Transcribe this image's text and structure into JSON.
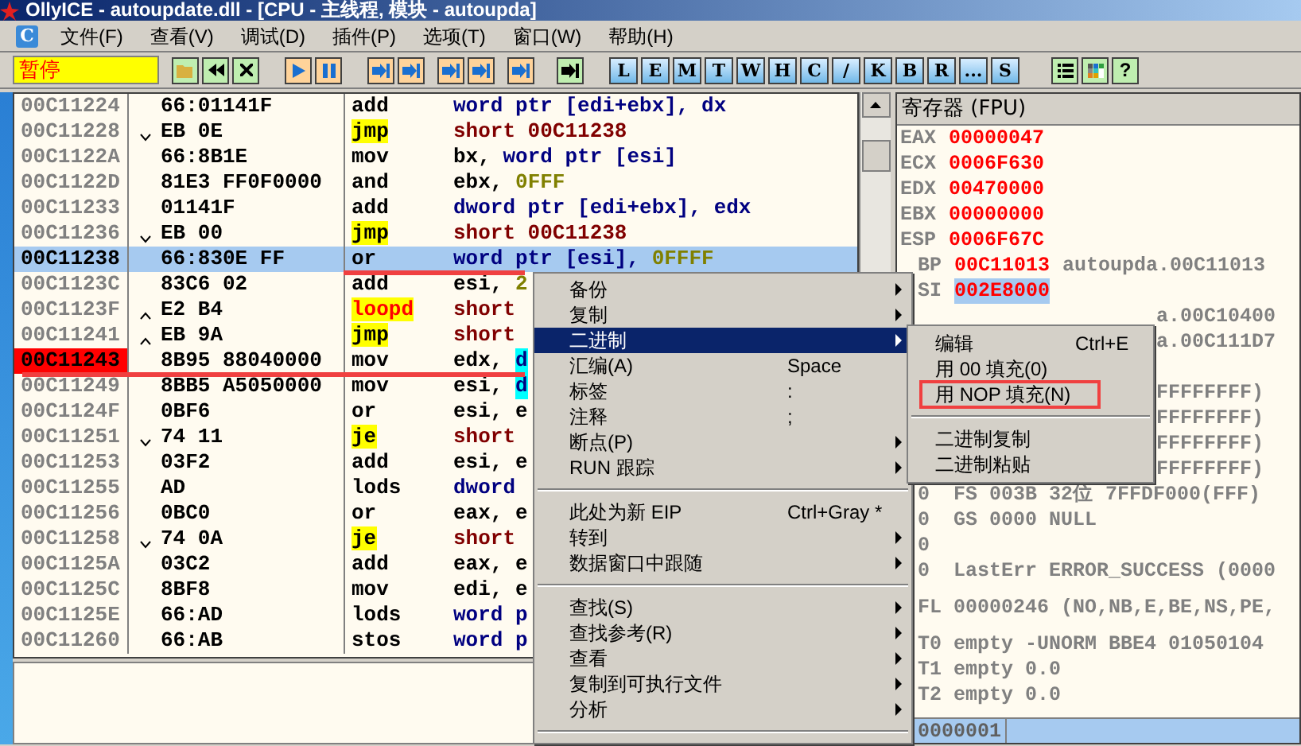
{
  "window": {
    "title": "OllyICE - autoupdate.dll - [CPU - 主线程, 模块 - autoupda]"
  },
  "menu_icon": "C",
  "menu": [
    "文件(F)",
    "查看(V)",
    "调试(D)",
    "插件(P)",
    "选项(T)",
    "窗口(W)",
    "帮助(H)"
  ],
  "toolbar": {
    "status": "暂停",
    "panel_buttons": [
      "L",
      "E",
      "M",
      "T",
      "W",
      "H",
      "C",
      "/",
      "K",
      "B",
      "R",
      "...",
      "S"
    ],
    "help_button": "?"
  },
  "disassembly": {
    "rows": [
      {
        "address": "00C11224",
        "hex": "66:01141F",
        "kind": "plain",
        "mnemonic": "add",
        "operand": [
          {
            "text": "word ptr [edi+ebx], dx",
            "kind": "mem"
          }
        ],
        "selected": false,
        "breakpoint": false,
        "underlined": false
      },
      {
        "address": "00C11228",
        "hex": "EB 0E",
        "kind": "jump_down",
        "mnemonic": "jmp",
        "operand": [
          {
            "text": "short 00C11238",
            "kind": "jump"
          }
        ],
        "selected": false,
        "breakpoint": false,
        "underlined": false
      },
      {
        "address": "00C1122A",
        "hex": "66:8B1E",
        "kind": "plain",
        "mnemonic": "mov",
        "operand": [
          {
            "text": "bx, ",
            "kind": "reg"
          },
          {
            "text": "word ptr [esi]",
            "kind": "mem"
          }
        ],
        "selected": false,
        "breakpoint": false,
        "underlined": false
      },
      {
        "address": "00C1122D",
        "hex": "81E3 FF0F0000",
        "kind": "plain",
        "mnemonic": "and",
        "operand": [
          {
            "text": "ebx, ",
            "kind": "reg"
          },
          {
            "text": "0FFF",
            "kind": "const"
          }
        ],
        "selected": false,
        "breakpoint": false,
        "underlined": false
      },
      {
        "address": "00C11233",
        "hex": "01141F",
        "kind": "plain",
        "mnemonic": "add",
        "operand": [
          {
            "text": "dword ptr [edi+ebx], edx",
            "kind": "mem"
          }
        ],
        "selected": false,
        "breakpoint": false,
        "underlined": false
      },
      {
        "address": "00C11236",
        "hex": "EB 00",
        "kind": "jump_down",
        "mnemonic": "jmp",
        "operand": [
          {
            "text": "short 00C11238",
            "kind": "jump"
          }
        ],
        "selected": false,
        "breakpoint": false,
        "underlined": false
      },
      {
        "address": "00C11238",
        "hex": "66:830E FF",
        "kind": "plain",
        "mnemonic": "or",
        "operand": [
          {
            "text": "word ptr [esi], ",
            "kind": "mem"
          },
          {
            "text": "0FFFF",
            "kind": "const"
          }
        ],
        "selected": true,
        "breakpoint": false,
        "underlined": true
      },
      {
        "address": "00C1123C",
        "hex": "83C6 02",
        "kind": "plain",
        "mnemonic": "add",
        "operand": [
          {
            "text": "esi, ",
            "kind": "reg"
          },
          {
            "text": "2",
            "kind": "const"
          }
        ],
        "selected": false,
        "breakpoint": false,
        "underlined": false
      },
      {
        "address": "00C1123F",
        "hex": "E2 B4",
        "kind": "loop_up",
        "mnemonic": "loopd",
        "operand": [
          {
            "text": "short",
            "kind": "jump"
          }
        ],
        "selected": false,
        "breakpoint": false,
        "underlined": false
      },
      {
        "address": "00C11241",
        "hex": "EB 9A",
        "kind": "jump_up",
        "mnemonic": "jmp",
        "operand": [
          {
            "text": "short",
            "kind": "jump"
          }
        ],
        "selected": false,
        "breakpoint": false,
        "underlined": false
      },
      {
        "address": "00C11243",
        "hex": "8B95 88040000",
        "kind": "plain",
        "mnemonic": "mov",
        "operand": [
          {
            "text": "edx, ",
            "kind": "reg"
          },
          {
            "text": "d",
            "kind": "stack"
          }
        ],
        "selected": false,
        "breakpoint": true,
        "underlined": true
      },
      {
        "address": "00C11249",
        "hex": "8BB5 A5050000",
        "kind": "plain",
        "mnemonic": "mov",
        "operand": [
          {
            "text": "esi, ",
            "kind": "reg"
          },
          {
            "text": "d",
            "kind": "stack"
          }
        ],
        "selected": false,
        "breakpoint": false,
        "underlined": false
      },
      {
        "address": "00C1124F",
        "hex": "0BF6",
        "kind": "plain",
        "mnemonic": "or",
        "operand": [
          {
            "text": "esi, e",
            "kind": "reg"
          }
        ],
        "selected": false,
        "breakpoint": false,
        "underlined": false
      },
      {
        "address": "00C11251",
        "hex": "74 11",
        "kind": "jump_down",
        "mnemonic": "je",
        "operand": [
          {
            "text": "short",
            "kind": "jump"
          }
        ],
        "selected": false,
        "breakpoint": false,
        "underlined": false
      },
      {
        "address": "00C11253",
        "hex": "03F2",
        "kind": "plain",
        "mnemonic": "add",
        "operand": [
          {
            "text": "esi, e",
            "kind": "reg"
          }
        ],
        "selected": false,
        "breakpoint": false,
        "underlined": false
      },
      {
        "address": "00C11255",
        "hex": "AD",
        "kind": "plain",
        "mnemonic": "lods",
        "operand": [
          {
            "text": "dword",
            "kind": "mem"
          }
        ],
        "selected": false,
        "breakpoint": false,
        "underlined": false
      },
      {
        "address": "00C11256",
        "hex": "0BC0",
        "kind": "plain",
        "mnemonic": "or",
        "operand": [
          {
            "text": "eax, e",
            "kind": "reg"
          }
        ],
        "selected": false,
        "breakpoint": false,
        "underlined": false
      },
      {
        "address": "00C11258",
        "hex": "74 0A",
        "kind": "jump_down",
        "mnemonic": "je",
        "operand": [
          {
            "text": "short",
            "kind": "jump"
          }
        ],
        "selected": false,
        "breakpoint": false,
        "underlined": false
      },
      {
        "address": "00C1125A",
        "hex": "03C2",
        "kind": "plain",
        "mnemonic": "add",
        "operand": [
          {
            "text": "eax, e",
            "kind": "reg"
          }
        ],
        "selected": false,
        "breakpoint": false,
        "underlined": false
      },
      {
        "address": "00C1125C",
        "hex": "8BF8",
        "kind": "plain",
        "mnemonic": "mov",
        "operand": [
          {
            "text": "edi, e",
            "kind": "reg"
          }
        ],
        "selected": false,
        "breakpoint": false,
        "underlined": false
      },
      {
        "address": "00C1125E",
        "hex": "66:AD",
        "kind": "plain",
        "mnemonic": "lods",
        "operand": [
          {
            "text": "word p",
            "kind": "mem"
          }
        ],
        "selected": false,
        "breakpoint": false,
        "underlined": false
      },
      {
        "address": "00C11260",
        "hex": "66:AB",
        "kind": "plain",
        "mnemonic": "stos",
        "operand": [
          {
            "text": "word p",
            "kind": "mem"
          }
        ],
        "selected": false,
        "breakpoint": false,
        "underlined": false
      }
    ]
  },
  "registers": {
    "title": "寄存器 (FPU)",
    "rows": [
      {
        "kind": "register",
        "name": "EAX",
        "value": "00000047",
        "changed": true,
        "selected": false
      },
      {
        "kind": "register",
        "name": "ECX",
        "value": "0006F630",
        "changed": true,
        "selected": false
      },
      {
        "kind": "register",
        "name": "EDX",
        "value": "00470000",
        "changed": true,
        "selected": false
      },
      {
        "kind": "register",
        "name": "EBX",
        "value": "00000000",
        "changed": true,
        "selected": false
      },
      {
        "kind": "register",
        "name": "ESP",
        "value": "0006F67C",
        "changed": true,
        "selected": false
      },
      {
        "kind": "register_partial",
        "name": "BP",
        "value": "00C11013",
        "comment": "autoupda.00C11013",
        "changed": true,
        "selected": false
      },
      {
        "kind": "register_partial",
        "name": "SI",
        "value": "002E8000",
        "changed": true,
        "selected": true
      },
      {
        "kind": "line_past_submenu",
        "text": "a.00C10400"
      },
      {
        "kind": "line_past_submenu",
        "text": "a.00C111D7"
      },
      {
        "kind": "blank"
      },
      {
        "kind": "line_past_submenu",
        "text": "FFFFFFFF)"
      },
      {
        "kind": "line_past_submenu",
        "text": "FFFFFFFF)"
      },
      {
        "kind": "line_past_submenu",
        "text": "FFFFFFFF)"
      },
      {
        "kind": "line_past_submenu",
        "text": "FFFFFFFF)"
      },
      {
        "kind": "line",
        "text": "0  FS 003B 32位 7FFDF000(FFF)"
      },
      {
        "kind": "line",
        "text": "0  GS 0000 NULL"
      },
      {
        "kind": "line",
        "text": "0"
      },
      {
        "kind": "line",
        "text": "0  LastErr ERROR_SUCCESS (0000"
      },
      {
        "kind": "gap"
      },
      {
        "kind": "line",
        "text": "FL 00000246 (NO,NB,E,BE,NS,PE,"
      },
      {
        "kind": "gap"
      },
      {
        "kind": "line",
        "text": "T0 empty -UNORM BBE4 01050104"
      },
      {
        "kind": "line",
        "text": "T1 empty 0.0"
      },
      {
        "kind": "line",
        "text": "T2 empty 0.0"
      }
    ],
    "status_value": "0000001"
  },
  "context_menu": {
    "items": [
      {
        "kind": "item",
        "label": "备份",
        "submenu": true,
        "selected": false
      },
      {
        "kind": "item",
        "label": "复制",
        "submenu": true,
        "selected": false
      },
      {
        "kind": "item",
        "label": "二进制",
        "submenu": true,
        "selected": true
      },
      {
        "kind": "item",
        "label": "汇编(A)",
        "shortcut": "Space",
        "submenu": false,
        "selected": false
      },
      {
        "kind": "item",
        "label": "标签",
        "shortcut": ":",
        "submenu": false,
        "selected": false
      },
      {
        "kind": "item",
        "label": "注释",
        "shortcut": ";",
        "submenu": false,
        "selected": false
      },
      {
        "kind": "item",
        "label": "断点(P)",
        "submenu": true,
        "selected": false
      },
      {
        "kind": "item",
        "label": "RUN 跟踪",
        "submenu": true,
        "selected": false
      },
      {
        "kind": "separator"
      },
      {
        "kind": "item",
        "label": "此处为新 EIP",
        "shortcut": "Ctrl+Gray *",
        "submenu": false,
        "selected": false
      },
      {
        "kind": "item",
        "label": "转到",
        "submenu": true,
        "selected": false
      },
      {
        "kind": "item",
        "label": "数据窗口中跟随",
        "submenu": true,
        "selected": false
      },
      {
        "kind": "separator"
      },
      {
        "kind": "item",
        "label": "查找(S)",
        "submenu": true,
        "selected": false
      },
      {
        "kind": "item",
        "label": "查找参考(R)",
        "submenu": true,
        "selected": false
      },
      {
        "kind": "item",
        "label": "查看",
        "submenu": true,
        "selected": false
      },
      {
        "kind": "item",
        "label": "复制到可执行文件",
        "submenu": true,
        "selected": false
      },
      {
        "kind": "item",
        "label": "分析",
        "submenu": true,
        "selected": false
      },
      {
        "kind": "separator"
      }
    ]
  },
  "submenu": {
    "items": [
      {
        "kind": "item",
        "label": "编辑",
        "shortcut": "Ctrl+E",
        "annotated": false
      },
      {
        "kind": "item",
        "label": "用 00 填充(0)",
        "annotated": false
      },
      {
        "kind": "item",
        "label": "用 NOP 填充(N)",
        "annotated": true
      },
      {
        "kind": "separator"
      },
      {
        "kind": "item",
        "label": "二进制复制",
        "annotated": false
      },
      {
        "kind": "item",
        "label": "二进制粘贴",
        "annotated": false
      }
    ]
  }
}
